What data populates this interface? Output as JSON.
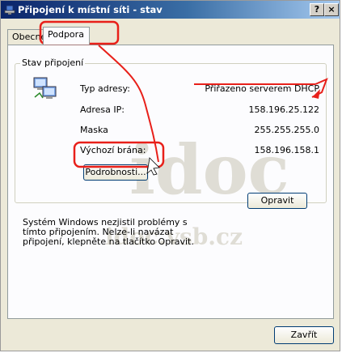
{
  "window": {
    "title": "Připojení k místní síti - stav",
    "help_button": "?",
    "close_button": "×"
  },
  "tabs": [
    {
      "label": "Obecné",
      "active": false
    },
    {
      "label": "Podpora",
      "active": true
    }
  ],
  "status_group": {
    "label": "Stav připojení",
    "rows": [
      {
        "label": "Typ adresy:",
        "value": "Přiřazeno serverem DHCP"
      },
      {
        "label": "Adresa IP:",
        "value": "158.196.25.122"
      },
      {
        "label": "Maska",
        "value": "255.255.255.0"
      },
      {
        "label": "Výchozí brána:",
        "value": "158.196.158.1"
      }
    ],
    "details_button": "Podrobnosti..."
  },
  "message": "Systém Windows nezjistil problémy s tímto připojením. Nelze-li navázat připojení, klepněte na tlačítko Opravit.",
  "repair_button": "Opravit",
  "close_button": "Zavřít",
  "watermark": {
    "large": "idoc",
    "small": "idoc.vsb.cz"
  },
  "colors": {
    "annotation": "#e8201a",
    "titlebar_start": "#0a246a",
    "titlebar_end": "#a6caf0"
  }
}
